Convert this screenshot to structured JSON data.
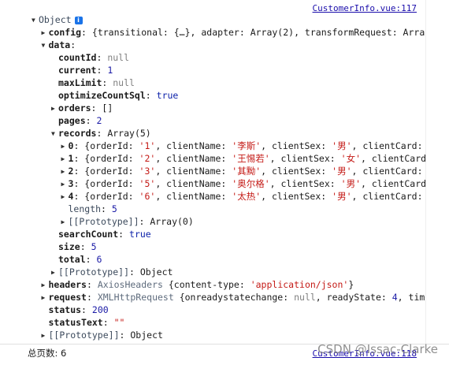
{
  "source_link": "CustomerInfo.vue:117",
  "root_label": "Object",
  "info_badge": "i",
  "rows": [
    {
      "indent": 0,
      "tri": "▼",
      "parts": [
        [
          "key-dim",
          "Object"
        ]
      ],
      "badge": true
    },
    {
      "indent": 1,
      "tri": "▶",
      "parts": [
        [
          "key",
          "config"
        ],
        [
          "",
          "{transitional: {…}, adapter: Array(2), transformRequest: Array(1"
        ]
      ]
    },
    {
      "indent": 1,
      "tri": "▼",
      "parts": [
        [
          "key",
          "data"
        ],
        [
          "",
          ""
        ]
      ]
    },
    {
      "indent": 2,
      "tri": "",
      "parts": [
        [
          "key",
          "countId"
        ],
        [
          "null",
          "null"
        ]
      ]
    },
    {
      "indent": 2,
      "tri": "",
      "parts": [
        [
          "key",
          "current"
        ],
        [
          "num",
          "1"
        ]
      ]
    },
    {
      "indent": 2,
      "tri": "",
      "parts": [
        [
          "key",
          "maxLimit"
        ],
        [
          "null",
          "null"
        ]
      ]
    },
    {
      "indent": 2,
      "tri": "",
      "parts": [
        [
          "key",
          "optimizeCountSql"
        ],
        [
          "kw",
          "true"
        ]
      ]
    },
    {
      "indent": 2,
      "tri": "▶",
      "parts": [
        [
          "key",
          "orders"
        ],
        [
          "",
          "[]"
        ]
      ]
    },
    {
      "indent": 2,
      "tri": "",
      "parts": [
        [
          "key",
          "pages"
        ],
        [
          "num",
          "2"
        ]
      ]
    },
    {
      "indent": 2,
      "tri": "▼",
      "parts": [
        [
          "key",
          "records"
        ],
        [
          "",
          "Array(5)"
        ]
      ]
    },
    {
      "indent": 3,
      "tri": "▶",
      "parts": [
        [
          "key",
          "0"
        ],
        [
          "",
          "{orderId: "
        ],
        [
          "str",
          "'1'"
        ],
        [
          "",
          ", clientName: "
        ],
        [
          "str",
          "'李斯'"
        ],
        [
          "",
          ", clientSex: "
        ],
        [
          "str",
          "'男'"
        ],
        [
          "",
          ", clientCard: "
        ],
        [
          "str",
          "'3"
        ]
      ]
    },
    {
      "indent": 3,
      "tri": "▶",
      "parts": [
        [
          "key",
          "1"
        ],
        [
          "",
          "{orderId: "
        ],
        [
          "str",
          "'2'"
        ],
        [
          "",
          ", clientName: "
        ],
        [
          "str",
          "'王惕若'"
        ],
        [
          "",
          ", clientSex: "
        ],
        [
          "str",
          "'女'"
        ],
        [
          "",
          ", clientCard:"
        ]
      ]
    },
    {
      "indent": 3,
      "tri": "▶",
      "parts": [
        [
          "key",
          "2"
        ],
        [
          "",
          "{orderId: "
        ],
        [
          "str",
          "'3'"
        ],
        [
          "",
          ", clientName: "
        ],
        [
          "str",
          "'其黝'"
        ],
        [
          "",
          ", clientSex: "
        ],
        [
          "str",
          "'男'"
        ],
        [
          "",
          ", clientCard: "
        ],
        [
          "str",
          "'3"
        ]
      ]
    },
    {
      "indent": 3,
      "tri": "▶",
      "parts": [
        [
          "key",
          "3"
        ],
        [
          "",
          "{orderId: "
        ],
        [
          "str",
          "'5'"
        ],
        [
          "",
          ", clientName: "
        ],
        [
          "str",
          "'奥尔格'"
        ],
        [
          "",
          ", clientSex: "
        ],
        [
          "str",
          "'男'"
        ],
        [
          "",
          ", clientCard:"
        ]
      ]
    },
    {
      "indent": 3,
      "tri": "▶",
      "parts": [
        [
          "key",
          "4"
        ],
        [
          "",
          "{orderId: "
        ],
        [
          "str",
          "'6'"
        ],
        [
          "",
          ", clientName: "
        ],
        [
          "str",
          "'太热'"
        ],
        [
          "",
          ", clientSex: "
        ],
        [
          "str",
          "'男'"
        ],
        [
          "",
          ", clientCard: "
        ],
        [
          "str",
          "'3"
        ]
      ]
    },
    {
      "indent": 3,
      "tri": "",
      "parts": [
        [
          "key-dim",
          "length"
        ],
        [
          "num",
          "5"
        ]
      ]
    },
    {
      "indent": 3,
      "tri": "▶",
      "parts": [
        [
          "key-dim",
          "[[Prototype]]"
        ],
        [
          "",
          "Array(0)"
        ]
      ]
    },
    {
      "indent": 2,
      "tri": "",
      "parts": [
        [
          "key",
          "searchCount"
        ],
        [
          "kw",
          "true"
        ]
      ]
    },
    {
      "indent": 2,
      "tri": "",
      "parts": [
        [
          "key",
          "size"
        ],
        [
          "num",
          "5"
        ]
      ]
    },
    {
      "indent": 2,
      "tri": "",
      "parts": [
        [
          "key",
          "total"
        ],
        [
          "num",
          "6"
        ]
      ]
    },
    {
      "indent": 2,
      "tri": "▶",
      "parts": [
        [
          "key-dim",
          "[[Prototype]]"
        ],
        [
          "",
          "Object"
        ]
      ]
    },
    {
      "indent": 1,
      "tri": "▶",
      "parts": [
        [
          "key",
          "headers"
        ],
        [
          "cls",
          "AxiosHeaders "
        ],
        [
          "",
          "{content-type: "
        ],
        [
          "str",
          "'application/json'"
        ],
        [
          "",
          "}"
        ]
      ]
    },
    {
      "indent": 1,
      "tri": "▶",
      "parts": [
        [
          "key",
          "request"
        ],
        [
          "cls",
          "XMLHttpRequest "
        ],
        [
          "",
          "{onreadystatechange: "
        ],
        [
          "null",
          "null"
        ],
        [
          "",
          ", readyState: "
        ],
        [
          "num",
          "4"
        ],
        [
          "",
          ", timeou"
        ]
      ]
    },
    {
      "indent": 1,
      "tri": "",
      "parts": [
        [
          "key",
          "status"
        ],
        [
          "num",
          "200"
        ]
      ]
    },
    {
      "indent": 1,
      "tri": "",
      "parts": [
        [
          "key",
          "statusText"
        ],
        [
          "str",
          "\"\""
        ]
      ]
    },
    {
      "indent": 1,
      "tri": "▶",
      "parts": [
        [
          "key-dim",
          "[[Prototype]]"
        ],
        [
          "",
          "Object"
        ]
      ]
    }
  ],
  "footer": {
    "total_label": "总页数: 6",
    "link": "CustomerInfo.vue:118",
    "watermark": "CSDN @Issac-Clarke"
  }
}
